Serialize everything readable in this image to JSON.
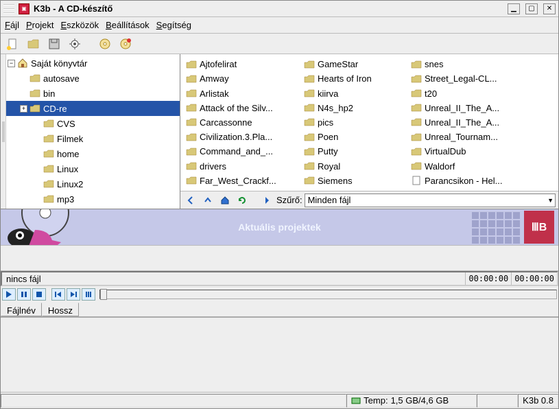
{
  "title": "K3b - A CD-készítő",
  "menu": {
    "file": "Fájl",
    "project": "Projekt",
    "tools": "Eszközök",
    "settings": "Beállítások",
    "help": "Segítség"
  },
  "tree": {
    "root": "Saját könyvtár",
    "items": [
      {
        "label": "autosave",
        "indent": 1,
        "exp": ""
      },
      {
        "label": "bin",
        "indent": 1,
        "exp": ""
      },
      {
        "label": "CD-re",
        "indent": 1,
        "exp": "+",
        "selected": true
      },
      {
        "label": "CVS",
        "indent": 2,
        "exp": ""
      },
      {
        "label": "Filmek",
        "indent": 2,
        "exp": ""
      },
      {
        "label": "home",
        "indent": 2,
        "exp": ""
      },
      {
        "label": "Linux",
        "indent": 2,
        "exp": ""
      },
      {
        "label": "Linux2",
        "indent": 2,
        "exp": ""
      },
      {
        "label": "mp3",
        "indent": 2,
        "exp": ""
      }
    ]
  },
  "files": {
    "col1": [
      "Ajtofelirat",
      "Amway",
      "Arlistak",
      "Attack of the Silv...",
      "Carcassonne",
      "Civilization.3.Pla...",
      "Command_and_...",
      "drivers",
      "Far_West_Crackf..."
    ],
    "col2": [
      "GameStar",
      "Hearts of Iron",
      "kiirva",
      "N4s_hp2",
      "pics",
      "Poen",
      "Putty",
      "Royal",
      "Siemens"
    ],
    "col3": [
      "snes",
      "Street_Legal-CL...",
      "t20",
      "Unreal_II_The_A...",
      "Unreal_II_The_A...",
      "Unreal_Tournam...",
      "VirtualDub",
      "Waldorf",
      "Parancsikon - Hel..."
    ]
  },
  "filter": {
    "label": "Szűrő:",
    "value": "Minden fájl"
  },
  "banner": "Aktuális projektek",
  "player": {
    "status": "nincs fájl",
    "t1": "00:00:00",
    "t2": "00:00:00"
  },
  "columns": {
    "c1": "Fájlnév",
    "c2": "Hossz"
  },
  "status": {
    "temp_label": "Temp:",
    "temp_value": "1,5 GB/4,6 GB",
    "version": "K3b 0.8"
  }
}
